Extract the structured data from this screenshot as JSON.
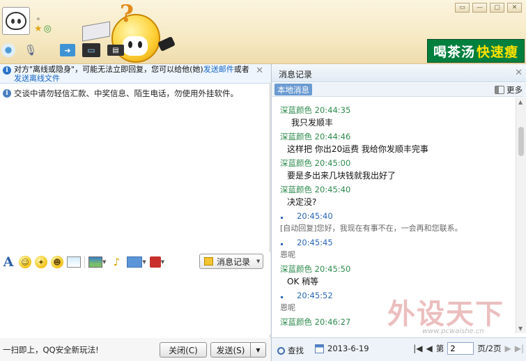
{
  "header": {
    "nickname": "。",
    "ad": {
      "part1": "喝茶汤",
      "part2": "快速瘦"
    }
  },
  "notice": {
    "text_before": "对方\"离线或隐身\"，可能无法立即回复，您可以给他(她)",
    "link_mail": "发送邮件",
    "text_middle": "或者",
    "link_file": "发送离线文件"
  },
  "warning": "交谈中请勿轻信汇款、中奖信息、陌生电话，勿使用外挂软件。",
  "toolbar": {
    "history_label": "消息记录"
  },
  "bottom": {
    "tip": "一扫即上，QQ安全新玩法!",
    "close_label": "关闭(C)",
    "send_label": "发送(S)"
  },
  "history_panel": {
    "title": "消息记录",
    "tab_local": "本地消息",
    "more_label": "更多",
    "entries": [
      {
        "head": "深蓝颜色  20:44:35",
        "body": "我只发顺丰"
      },
      {
        "head": "深蓝颜色  20:44:46",
        "body": "这样把  你出20运费  我给你发顺丰完事"
      },
      {
        "head": "深蓝颜色  20:45:00",
        "body": "要是多出来几块钱就我出好了"
      },
      {
        "head": "深蓝颜色  20:45:40",
        "body": "决定没?"
      },
      {
        "head": "20:45:40",
        "body": "[自动回复]您好，我现在有事不在，一会再和您联系。"
      },
      {
        "head": "20:45:45",
        "body": "恩呢"
      },
      {
        "head": "深蓝颜色  20:45:50",
        "body": "OK  稍等"
      },
      {
        "head": "20:45:52",
        "body": "恩呢"
      },
      {
        "head": "深蓝颜色  20:46:27",
        "body": ""
      }
    ],
    "footer": {
      "find_label": "查找",
      "date": "2013-6-19",
      "page_prefix": "第",
      "page_value": "2",
      "page_suffix": "页/2页"
    }
  },
  "watermark": {
    "main": "外设天下",
    "sub": "www.pcwaishe.cn"
  }
}
